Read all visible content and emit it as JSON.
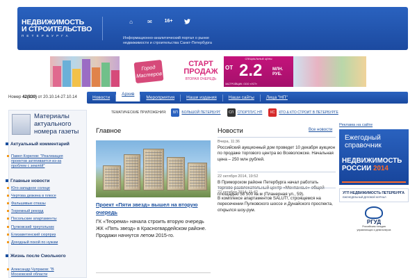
{
  "header": {
    "logo_line1": "НЕДВИЖИМОСТЬ",
    "logo_line2": "И СТРОИТЕЛЬСТВО",
    "logo_sub": "ПЕТЕРБУРГА",
    "icons": [
      "home-icon",
      "mail-icon",
      "age-rating",
      "twitter-icon"
    ],
    "age_rating": "16+",
    "tagline_line1": "Информационно-аналитический портал о рынке",
    "tagline_line2": "недвижимости и строительства Санкт-Петербурга"
  },
  "banner": {
    "brand": "Город Мастеров",
    "start_line1": "СТАРТ",
    "start_line2": "ПРОДАЖ",
    "start_sub": "ВТОРАЯ ОЧЕРЕДЬ",
    "price_top": "СПЕЦИАЛЬНЫЕ ЦЕНЫ",
    "price_prefix": "ОТ",
    "price_value": "2.2",
    "price_unit_1": "МЛН.",
    "price_unit_2": "РУБ.",
    "price_bottom": "ЗАСТРОЙЩИК: ООО «ЛСТ»"
  },
  "issue": {
    "label": "Номер",
    "number": "42(830)",
    "dates": "от 20.10.14-27.10.14"
  },
  "nav": {
    "items": [
      "Новости",
      "Архив",
      "Мероприятия",
      "Наши издания",
      "Наши сайты",
      "Лица \"НП\""
    ],
    "active_index": 1
  },
  "apps": {
    "label": "ТЕМАТИЧЕСКИЕ ПРИЛОЖЕНИЯ:",
    "items": [
      {
        "badge": "БП",
        "label": "БОЛЬШОЙ ПЕТЕРБУРГ"
      },
      {
        "badge": "СЛ",
        "label": "СПОРТЛУС НП"
      },
      {
        "badge": "КС",
        "label": "КТО & КТО СТРОИТ В ПЕТЕРБУРГЕ"
      }
    ]
  },
  "sidebar": {
    "title_line1": "Материалы",
    "title_line2": "актуального",
    "title_line3": "номера газеты",
    "sections": [
      {
        "title": "Актуальный комментарий",
        "links": [
          "Павел Корелов: \"Реализация проектов затягивается из-за проблем с землёй\""
        ]
      },
      {
        "title": "Главные новости",
        "links": [
          "Юго-западное солнце",
          "Чертова дюжина в плюсе",
          "Фальшивые отказы",
          "Тюремный рекорд",
          "Посольские апартаменты",
          "Пулковский треугольник",
          "Елизаветинский сюрприз",
          "Доходный покой по нужам"
        ]
      },
      {
        "title": "Жизнь после Смольного",
        "links": [
          "Александр Чупраков: \"В Московской области"
        ]
      }
    ]
  },
  "main": {
    "heading": "Главное",
    "link": "Проект «Пяти звезд» вышел на вторую очередь",
    "text": "ГК «Теорема» начала строить вторую очередь ЖК «Пять звезд» в Красногвардейском районе. Продажи начнутся летом 2015-го."
  },
  "news": {
    "heading": "Новости",
    "all_link": "Все новости",
    "items": [
      {
        "date": "Вчера, 11:36",
        "text": "Российский аукционный дом проведет 10 декабря аукцион по продаже торгового центра во Всеволожске. Начальная цена – 250 млн рублей."
      },
      {
        "date": "22 октября 2014, 19:52",
        "text": "В Приморском районе Петербурга начал работать торгово-развлекательный центр «Монпансье» общей площадью 58 500 кв.м (Планерная ул., 59)."
      },
      {
        "date": "22 октября 2014, 11:42",
        "text": "В комплексе апартаментов SALUT!, строящемся на пересечении Пулковского шоссе и Дунайского проспекта, открылся шоу-рум."
      }
    ]
  },
  "ads": {
    "label": "Реклама на сайте",
    "ad1_title_1": "Ежегодный",
    "ad1_title_2": "справочник",
    "ad1_big_1": "НЕДВИЖИМОСТЬ",
    "ad1_big_2": "РОССИИ",
    "ad1_year": "2014",
    "ad2_title": "УГП НЕДВИЖИМОСТЬ ПЕТЕРБУРГА",
    "ad2_sub": "ЕЖЕНЕДЕЛЬНЫЙ ДЕЛОВОЙ ЖУРНАЛ",
    "ad3_name": "РГУД",
    "ad3_desc_1": "Российская гильдия",
    "ad3_desc_2": "управляющих и девелоперов"
  }
}
